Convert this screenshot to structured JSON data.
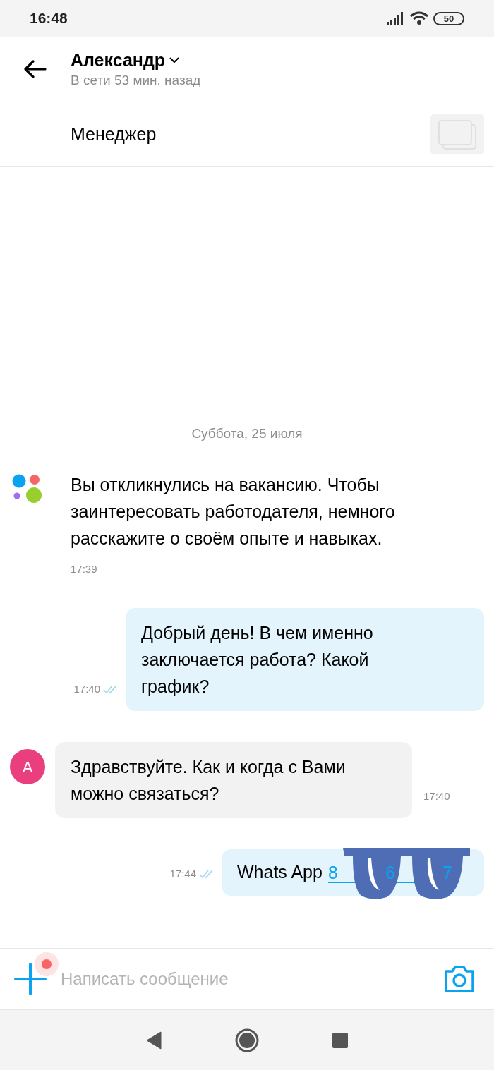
{
  "status_bar": {
    "time": "16:48",
    "battery": "50"
  },
  "header": {
    "name": "Александр",
    "status": "В сети 53 мин. назад"
  },
  "item_row": {
    "title": "Менеджер"
  },
  "date_divider": "Суббота, 25 июля",
  "messages": [
    {
      "kind": "system",
      "text": "Вы откликнулись на вакансию. Чтобы заинтересовать работодателя, немного расскажите о своём опыте и навыках.",
      "time": "17:39"
    },
    {
      "kind": "outgoing",
      "text": "Добрый день! В чем именно заключается работа? Какой график?",
      "time": "17:40",
      "read": true
    },
    {
      "kind": "incoming",
      "avatar": "А",
      "text": "Здравствуйте. Как и когда с Вами можно связаться?",
      "time": "17:40"
    },
    {
      "kind": "outgoing",
      "text": "Whats App",
      "link_fragments": [
        "8",
        "6",
        "7"
      ],
      "redacted": true,
      "time": "17:44",
      "read": true
    }
  ],
  "composer": {
    "placeholder": "Написать сообщение",
    "attach_badge": true
  }
}
